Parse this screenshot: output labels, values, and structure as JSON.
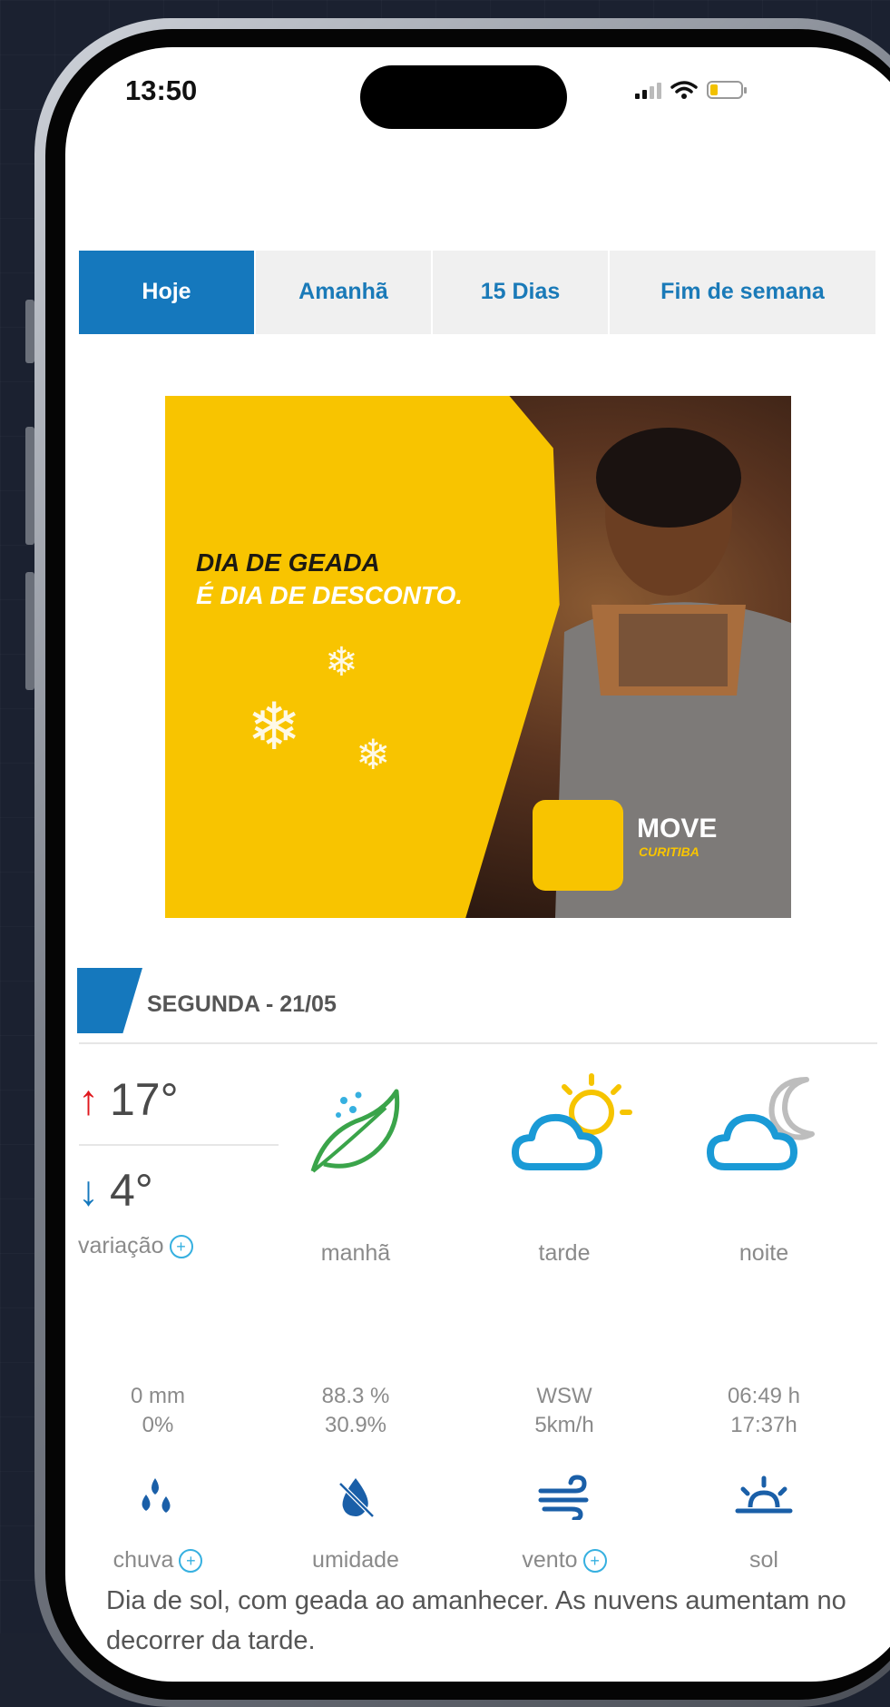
{
  "status_bar": {
    "time": "13:50"
  },
  "tabs": [
    {
      "label": "Hoje",
      "active": true
    },
    {
      "label": "Amanhã",
      "active": false
    },
    {
      "label": "15 Dias",
      "active": false
    },
    {
      "label": "Fim de semana",
      "active": false
    }
  ],
  "ad": {
    "headline_line1": "DIA DE GEADA",
    "headline_line2": "É DIA DE DESCONTO.",
    "brand": "MOVE",
    "brand_sub": "CURITIBA",
    "accent": "#f8c400"
  },
  "forecast": {
    "day": "SEGUNDA - 21/05",
    "max_temp": "17°",
    "min_temp": "4°",
    "variation_label": "variação",
    "periods": [
      {
        "label": "manhã",
        "icon": "leaf-frost-icon"
      },
      {
        "label": "tarde",
        "icon": "cloud-sun-icon"
      },
      {
        "label": "noite",
        "icon": "cloud-moon-icon"
      }
    ],
    "stats": {
      "rain": {
        "line1": "0 mm",
        "line2": "0%",
        "label": "chuva"
      },
      "humidity": {
        "line1": "88.3 %",
        "line2": "30.9%",
        "label": "umidade"
      },
      "wind": {
        "line1": "WSW",
        "line2": "5km/h",
        "label": "vento"
      },
      "sun": {
        "line1": "06:49 h",
        "line2": "17:37h",
        "label": "sol"
      }
    },
    "description": "Dia de sol, com geada ao amanhecer. As nuvens aumentam no decorrer da tarde."
  },
  "colors": {
    "primary": "#1578bd",
    "max_arrow": "#e0181e",
    "min_arrow": "#1578bd",
    "accent_plus": "#36b0e0"
  }
}
